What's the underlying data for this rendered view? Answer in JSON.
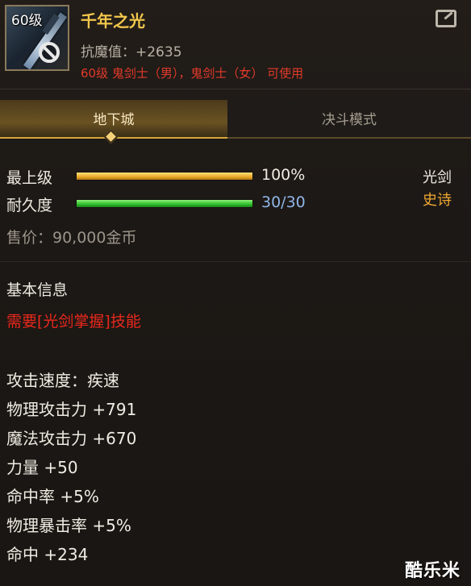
{
  "item": {
    "level_badge": "60级",
    "name": "千年之光",
    "resist": "抗魔值：+2635",
    "usable_by": "60级 鬼剑士（男），鬼剑士（女） 可使用"
  },
  "tabs": [
    {
      "label": "地下城",
      "active": true
    },
    {
      "label": "决斗模式",
      "active": false
    }
  ],
  "stats": {
    "upgrade_label": "最上级",
    "upgrade_value": "100%",
    "upgrade_fraction": 1.0,
    "durability_label": "耐久度",
    "durability_value": "30/30",
    "durability_fraction": 1.0,
    "weapon_type": "光剑",
    "rarity": "史诗",
    "price": "售价：90,000金币"
  },
  "info": {
    "section_title": "基本信息",
    "requirement": "需要[光剑掌握]技能",
    "lines": [
      "攻击速度：疾速",
      "物理攻击力 +791",
      "魔法攻击力 +670",
      "力量 +50",
      "命中率 +5%",
      "物理暴击率 +5%",
      "命中 +234"
    ]
  },
  "watermark": "酷乐米",
  "colors": {
    "name": "#f2c74b",
    "rarity_epic": "#f0a832",
    "requirement": "#e8281c",
    "durability_value": "#8fb6e8"
  },
  "icons": {
    "item": "sword-icon",
    "restricted": "no-entry-icon",
    "share": "share-icon"
  }
}
